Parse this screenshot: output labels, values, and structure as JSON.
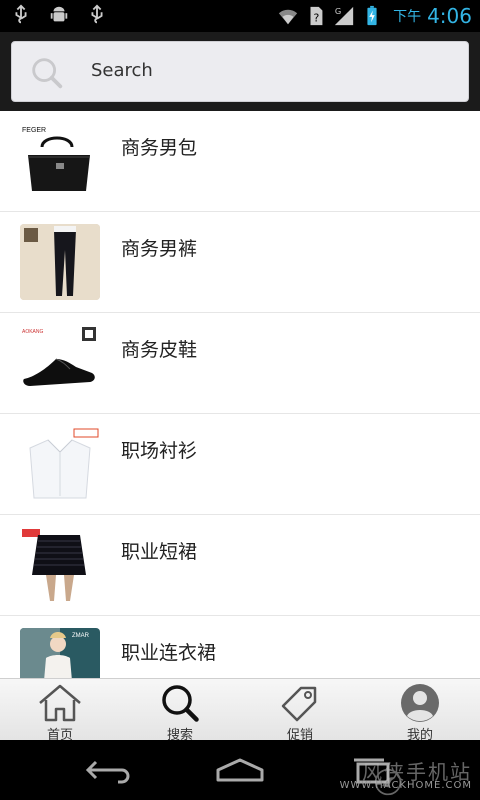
{
  "statusbar": {
    "ampm": "下午",
    "time": "4:06",
    "icons": [
      "usb-icon",
      "android-debug-icon",
      "usb-icon",
      "wifi-icon",
      "sim-unknown-icon",
      "signal-g-icon",
      "battery-charging-icon"
    ]
  },
  "search": {
    "placeholder": "Search"
  },
  "list": [
    {
      "label": "商务男包",
      "thumb": "business-bag"
    },
    {
      "label": "商务男裤",
      "thumb": "business-trousers"
    },
    {
      "label": "商务皮鞋",
      "thumb": "leather-shoes"
    },
    {
      "label": "职场衬衫",
      "thumb": "office-shirt"
    },
    {
      "label": "职业短裙",
      "thumb": "office-skirt"
    },
    {
      "label": "职业连衣裙",
      "thumb": "office-dress"
    }
  ],
  "tabs": [
    {
      "label": "首页",
      "icon": "home-icon"
    },
    {
      "label": "搜索",
      "icon": "search-icon"
    },
    {
      "label": "促销",
      "icon": "tag-icon"
    },
    {
      "label": "我的",
      "icon": "profile-icon"
    }
  ],
  "watermark": {
    "text": "风侠手机站",
    "url": "WWW.HACKHOME.COM"
  },
  "colors": {
    "status_accent": "#33b5e5",
    "header_bg": "#1b1b1b",
    "list_bg": "#ffffff"
  }
}
